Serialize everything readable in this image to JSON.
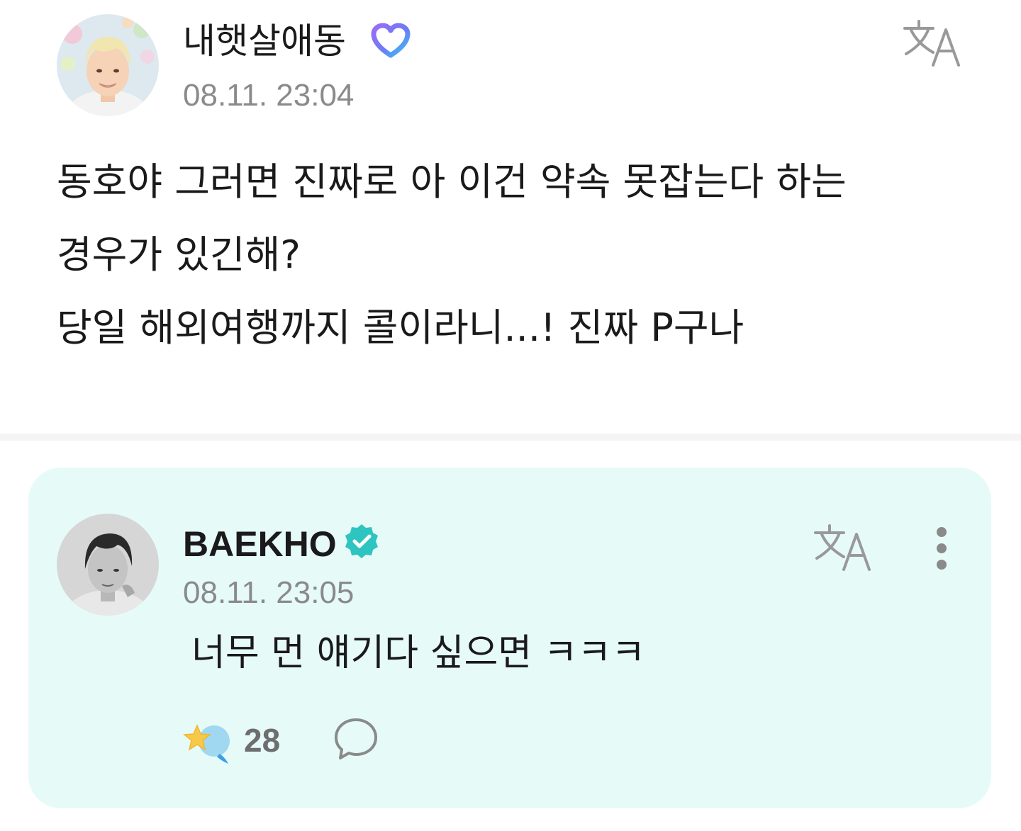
{
  "post": {
    "author_name": "내햇살애동",
    "timestamp": "08.11. 23:04",
    "body_lines": [
      "동호야 그러면 진짜로 아 이건 약속 못잡는다 하는",
      "경우가 있긴해?",
      "당일 해외여행까지 콜이라니...! 진짜 P구나"
    ],
    "icons": {
      "fan_badge": "heart-outline-icon",
      "translate": "translate-icon"
    }
  },
  "reply": {
    "author_name": "BAEKHO",
    "timestamp": "08.11. 23:05",
    "text": "너무 먼 얘기다 싶으면 ㅋㅋㅋ",
    "reaction_count": "28",
    "icons": {
      "verified": "verified-badge-icon",
      "translate": "translate-icon",
      "more": "more-vertical-icon",
      "reaction": "star-reaction-icon",
      "comment": "comment-bubble-icon"
    }
  },
  "colors": {
    "reply_card_background": "#e6fbf8",
    "verified_badge": "#2ec4c0",
    "timestamp_text": "#8a8a8a",
    "divider": "#f4f4f4"
  }
}
